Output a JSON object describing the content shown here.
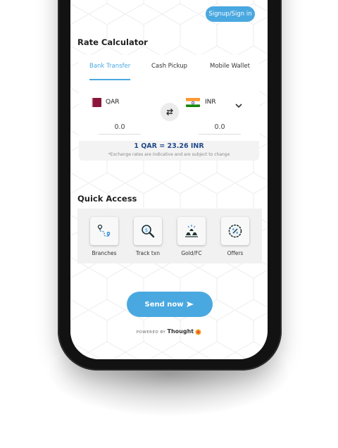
{
  "header": {
    "signup_label": "Signup/Sign in"
  },
  "rate_calculator": {
    "title": "Rate Calculator",
    "tabs": [
      {
        "label": "Bank Transfer",
        "active": true
      },
      {
        "label": "Cash Pickup",
        "active": false
      },
      {
        "label": "Mobile Wallet",
        "active": false
      }
    ],
    "from_currency": "QAR",
    "to_currency": "INR",
    "from_amount": "0.0",
    "to_amount": "0.0",
    "rate_text": "1 QAR = 23.26  INR",
    "disclaimer": "*Exchange rates are indicative and are subject to change"
  },
  "quick_access": {
    "title": "Quick Access",
    "items": [
      {
        "label": "Branches",
        "icon": "branches-map-icon"
      },
      {
        "label": "Track txn",
        "icon": "track-search-icon"
      },
      {
        "label": "Gold/FC",
        "icon": "gold-bars-icon"
      },
      {
        "label": "Offers",
        "icon": "offers-percent-icon"
      }
    ]
  },
  "send_button": {
    "label": "Send now"
  },
  "footer": {
    "powered_by": "POWERED BY",
    "brand": "Thought"
  },
  "colors": {
    "accent": "#4aa8e0",
    "rate_text": "#234b8a"
  }
}
